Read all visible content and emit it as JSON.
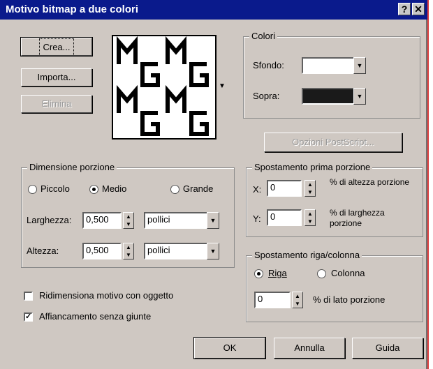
{
  "window": {
    "title": "Motivo bitmap a due colori",
    "help_label": "?",
    "close_label": "✕"
  },
  "actions": {
    "crea": "Crea...",
    "importa": "Importa...",
    "elimina": "Elimina",
    "postscript": "Opzioni PostScript..."
  },
  "colors": {
    "group": "Colori",
    "sfondo_label": "Sfondo:",
    "sopra_label": "Sopra:",
    "sfondo_value": "#ffffff",
    "sopra_value": "#1a1a1a"
  },
  "tile_size": {
    "group": "Dimensione porzione",
    "options": [
      "Piccolo",
      "Medio",
      "Grande"
    ],
    "selected": "Medio",
    "width_label": "Larghezza:",
    "width_value": "0,500",
    "width_unit": "pollici",
    "height_label": "Altezza:",
    "height_value": "0,500",
    "height_unit": "pollici"
  },
  "first_tile_offset": {
    "group": "Spostamento prima porzione",
    "x_label": "X:",
    "x_value": "0",
    "x_desc": "% di altezza porzione",
    "y_label": "Y:",
    "y_value": "0",
    "y_desc": "% di larghezza porzione"
  },
  "row_col_offset": {
    "group": "Spostamento riga/colonna",
    "options": [
      "Riga",
      "Colonna"
    ],
    "selected": "Riga",
    "value": "0",
    "desc": "% di lato porzione"
  },
  "checkboxes": {
    "resize": "Ridimensiona motivo con oggetto",
    "resize_checked": false,
    "seamless": "Affiancamento senza giunte",
    "seamless_checked": true
  },
  "buttons": {
    "ok": "OK",
    "cancel": "Annulla",
    "help": "Guida"
  }
}
